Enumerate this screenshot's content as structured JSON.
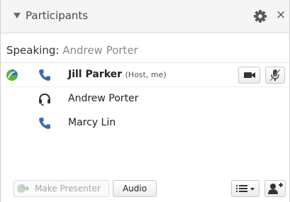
{
  "header": {
    "title": "Participants",
    "icons": {
      "collapse": "triangle-down-icon",
      "settings": "gear-icon",
      "close": "close-icon"
    },
    "close_glyph": "×"
  },
  "speaking": {
    "label": "Speaking:",
    "name": "Andrew Porter"
  },
  "participants": [
    {
      "name": "Jill Parker",
      "role": "(Host, me)",
      "presenter": true,
      "audio": "phone-icon",
      "controls": [
        "video-camera-icon",
        "mic-muted-icon"
      ]
    },
    {
      "name": "Andrew Porter",
      "role": "",
      "presenter": false,
      "audio": "headset-icon"
    },
    {
      "name": "Marcy Lin",
      "role": "",
      "presenter": false,
      "audio": "phone-icon"
    }
  ],
  "footer": {
    "make_presenter": "Make Presenter",
    "make_presenter_enabled": false,
    "audio": "Audio",
    "icons": {
      "list": "list-dropdown-icon",
      "add_user": "add-user-icon"
    }
  },
  "colors": {
    "phone": "#3c6aa8",
    "presenter_green": "#5bb33b",
    "presenter_blue": "#2f72c4",
    "header_bg": "#f5f5f5"
  }
}
